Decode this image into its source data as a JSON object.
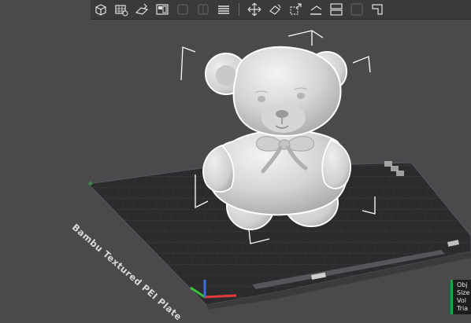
{
  "bed": {
    "label": "Bambu Textured PEI Plate"
  },
  "object_info": {
    "rows": [
      "Obj",
      "Size",
      "Vol",
      "Tria"
    ],
    "accent_color": "#1fa33e"
  },
  "toolbar": {
    "groups": [
      [
        "add-cube-icon",
        "add-plate-icon",
        "auto-orient-icon",
        "arrange-icon",
        "split-objects-icon",
        "split-parts-icon",
        "layers-icon"
      ],
      [
        "move-icon",
        "rotate-icon",
        "scale-icon",
        "lay-on-face-icon",
        "cut-icon",
        "support-paint-icon",
        "seam-paint-icon"
      ]
    ]
  },
  "colors": {
    "background": "#4a4a4d",
    "bed": "#2b2b2d",
    "model": "#d9d9d9",
    "toolbar": "#3a3a3c",
    "axis_x": "#e03a3a",
    "axis_y": "#3ac23a",
    "axis_z": "#3a6ee0"
  }
}
